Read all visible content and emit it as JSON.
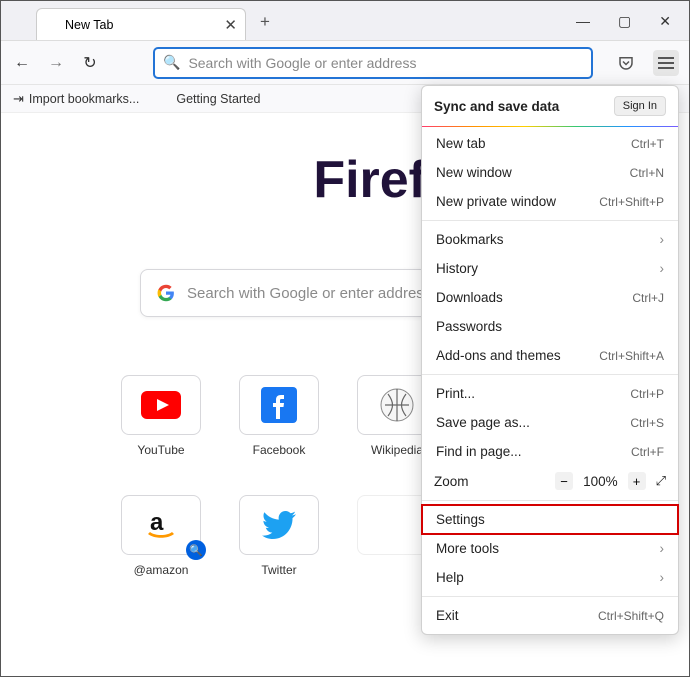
{
  "window": {
    "tab_title": "New Tab",
    "controls": {
      "min": "—",
      "max": "▢",
      "close": "✕"
    },
    "new_tab_plus": "+"
  },
  "toolbar": {
    "back": "←",
    "forward": "→",
    "reload": "↻",
    "url_placeholder": "Search with Google or enter address"
  },
  "bookmarks_bar": {
    "import": "Import bookmarks...",
    "getting_started": "Getting Started"
  },
  "hero": {
    "brand": "Firefox",
    "search_placeholder": "Search with Google or enter address"
  },
  "shortcuts": [
    {
      "label": "YouTube",
      "key": "youtube"
    },
    {
      "label": "Facebook",
      "key": "facebook"
    },
    {
      "label": "Wikipedia",
      "key": "wikipedia"
    },
    {
      "label": "",
      "key": "blank1"
    },
    {
      "label": "@amazon",
      "key": "amazon",
      "pinned": true
    },
    {
      "label": "Twitter",
      "key": "twitter"
    },
    {
      "label": "",
      "key": "blank2"
    },
    {
      "label": "",
      "key": "blank3"
    }
  ],
  "menu": {
    "sync_label": "Sync and save data",
    "sign_in": "Sign In",
    "items": [
      {
        "label": "New tab",
        "accel": "Ctrl+T"
      },
      {
        "label": "New window",
        "accel": "Ctrl+N"
      },
      {
        "label": "New private window",
        "accel": "Ctrl+Shift+P"
      }
    ],
    "group2": [
      {
        "label": "Bookmarks",
        "chev": true
      },
      {
        "label": "History",
        "chev": true
      },
      {
        "label": "Downloads",
        "accel": "Ctrl+J"
      },
      {
        "label": "Passwords"
      },
      {
        "label": "Add-ons and themes",
        "accel": "Ctrl+Shift+A"
      }
    ],
    "group3": [
      {
        "label": "Print...",
        "accel": "Ctrl+P"
      },
      {
        "label": "Save page as...",
        "accel": "Ctrl+S"
      },
      {
        "label": "Find in page...",
        "accel": "Ctrl+F"
      }
    ],
    "zoom": {
      "label": "Zoom",
      "value": "100%",
      "minus": "−",
      "plus": "+",
      "full": "⤢"
    },
    "settings": {
      "label": "Settings"
    },
    "group4": [
      {
        "label": "More tools",
        "chev": true
      },
      {
        "label": "Help",
        "chev": true
      }
    ],
    "exit": {
      "label": "Exit",
      "accel": "Ctrl+Shift+Q"
    }
  }
}
